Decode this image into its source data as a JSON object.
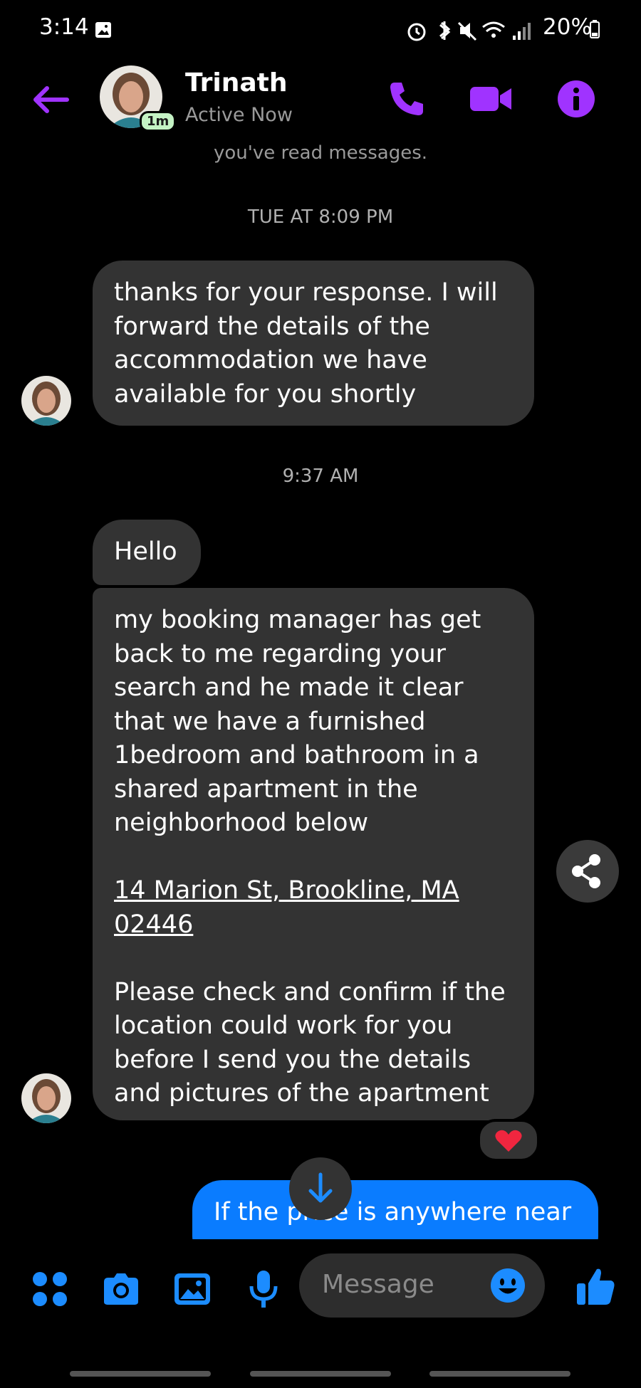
{
  "status_bar": {
    "time": "3:14",
    "battery": "20%"
  },
  "header": {
    "name": "Trinath",
    "status": "Active Now",
    "badge": "1m"
  },
  "chat": {
    "read_note": "you've read messages.",
    "timestamp1": "TUE AT 8:09 PM",
    "msg1": "thanks for your response. I will forward the details of the accommodation we have available for you shortly",
    "timestamp2": "9:37 AM",
    "msg2": "Hello",
    "msg3_part1": "my booking manager has get back to me regarding your search and he made it clear that we have a furnished 1bedroom and bathroom in a shared apartment in the neighborhood below",
    "msg3_address": "14 Marion St, Brookline, MA 02446",
    "msg3_part2": "Please check and confirm if the location could work for you before I send you the details and pictures of the apartment",
    "reaction": "❤️",
    "outgoing": "If the price is anywhere near"
  },
  "composer": {
    "placeholder": "Message"
  },
  "colors": {
    "accent_purple": "#a033ff",
    "accent_blue": "#0a7cff",
    "bubble": "#333333"
  }
}
